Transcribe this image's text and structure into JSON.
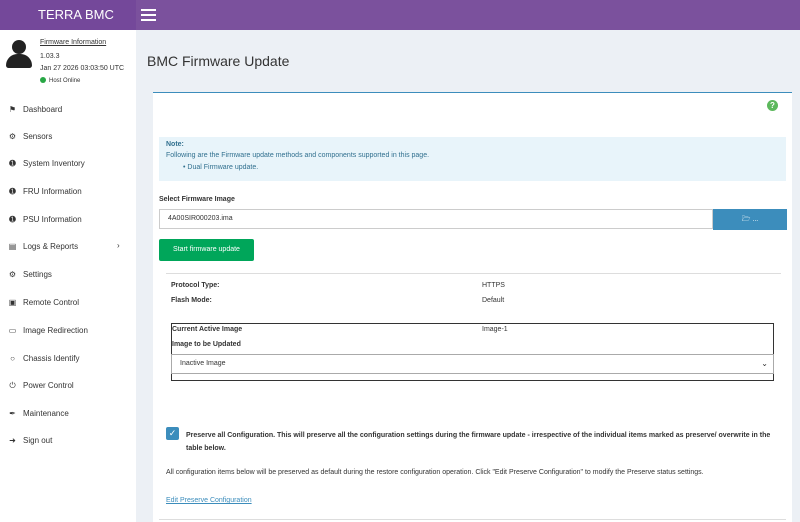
{
  "header": {
    "brand": "TERRA BMC",
    "menu_icon": "hamburger-icon"
  },
  "sidebar": {
    "user": {
      "firmware_link": "Firmware Information",
      "version": "1.03.3",
      "datetime": "Jan 27 2026 03:03:50 UTC",
      "host_status": "Host Online",
      "host_status_color": "#28a745"
    },
    "items": [
      {
        "label": "Dashboard",
        "icon": "dashboard-icon"
      },
      {
        "label": "Sensors",
        "icon": "sensors-icon"
      },
      {
        "label": "System Inventory",
        "icon": "info-icon"
      },
      {
        "label": "FRU Information",
        "icon": "info-icon"
      },
      {
        "label": "PSU Information",
        "icon": "info-icon"
      },
      {
        "label": "Logs & Reports",
        "icon": "chart-icon"
      },
      {
        "label": "Settings",
        "icon": "gear-icon"
      },
      {
        "label": "Remote Control",
        "icon": "monitor-icon"
      },
      {
        "label": "Image Redirection",
        "icon": "drive-icon"
      },
      {
        "label": "Chassis Identify",
        "icon": "bulb-icon"
      },
      {
        "label": "Power Control",
        "icon": "power-icon"
      },
      {
        "label": "Maintenance",
        "icon": "wrench-icon"
      },
      {
        "label": "Sign out",
        "icon": "sign-out-icon"
      }
    ]
  },
  "main": {
    "title": "BMC Firmware Update",
    "note": {
      "title": "Note:",
      "text": "Following are the Firmware update methods and components supported in this page.",
      "bullet": "Dual Firmware update."
    },
    "select_label": "Select Firmware Image",
    "file_value": "4A00SIR000203.ima",
    "browse_label": "...",
    "start_button": "Start firmware update",
    "info": {
      "protocol_label": "Protocol Type:",
      "protocol_value": "HTTPS",
      "flash_label": "Flash Mode:",
      "flash_value": "Default",
      "current_label": "Current Active Image",
      "current_value": "Image-1",
      "update_label": "Image to be Updated",
      "update_selected": "Inactive Image"
    },
    "preserve": {
      "checked": true,
      "text": "Preserve all Configuration. This will preserve all the configuration settings during the firmware update - irrespective of the individual items marked as preserve/ overwrite in the table below.",
      "note": "All configuration items below will be preserved as default during the restore configuration operation. Click \"Edit Preserve Configuration\" to modify the Preserve status settings.",
      "edit_link": "Edit Preserve Configuration"
    }
  },
  "colors": {
    "topbar": "#7b519d",
    "primary": "#3c8dbc",
    "success": "#00a65a"
  }
}
